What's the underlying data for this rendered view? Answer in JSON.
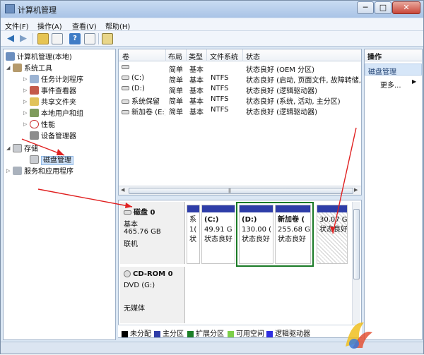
{
  "window": {
    "title": "计算机管理",
    "tooltip": "关闭",
    "min_glyph": "─",
    "max_glyph": "□",
    "close_glyph": "✕"
  },
  "menu": [
    "文件(F)",
    "操作(A)",
    "查看(V)",
    "帮助(H)"
  ],
  "toolbar": {
    "back_glyph": "◀",
    "forward_glyph": "▶",
    "help_glyph": "?"
  },
  "tree": {
    "items": [
      {
        "label": "计算机管理(本地)"
      },
      {
        "label": "系统工具"
      },
      {
        "label": "任务计划程序"
      },
      {
        "label": "事件查看器"
      },
      {
        "label": "共享文件夹"
      },
      {
        "label": "本地用户和组"
      },
      {
        "label": "性能"
      },
      {
        "label": "设备管理器"
      },
      {
        "label": "存储"
      },
      {
        "label": "磁盘管理"
      },
      {
        "label": "服务和应用程序"
      }
    ]
  },
  "volumes": {
    "headers": [
      "卷",
      "布局",
      "类型",
      "文件系统",
      "状态"
    ],
    "rows": [
      {
        "name": "",
        "layout": "简单",
        "type": "基本",
        "fs": "",
        "status": "状态良好 (OEM 分区)"
      },
      {
        "name": "(C:)",
        "layout": "简单",
        "type": "基本",
        "fs": "NTFS",
        "status": "状态良好 (启动, 页面文件, 故障转储,"
      },
      {
        "name": "(D:)",
        "layout": "简单",
        "type": "基本",
        "fs": "NTFS",
        "status": "状态良好 (逻辑驱动器)"
      },
      {
        "name": "系统保留",
        "layout": "简单",
        "type": "基本",
        "fs": "NTFS",
        "status": "状态良好 (系统, 活动, 主分区)"
      },
      {
        "name": "新加卷 (E:)",
        "layout": "简单",
        "type": "基本",
        "fs": "NTFS",
        "status": "状态良好 (逻辑驱动器)"
      }
    ],
    "scroll_left": "◀",
    "scroll_right": "▶",
    "scroll_grip": "|||"
  },
  "disks": [
    {
      "name": "磁盘 0",
      "kind": "基本",
      "size": "465.76 GB",
      "status": "联机",
      "partitions": [
        {
          "line1": "系",
          "line2": "1(",
          "line3": "状"
        },
        {
          "line1": "(C:)",
          "line2": "49.91 G",
          "line3": "状态良好"
        },
        {
          "line1": "(D:)",
          "line2": "130.00 (",
          "line3": "状态良好"
        },
        {
          "line1": "新加卷 (",
          "line2": "255.68 G",
          "line3": "状态良好"
        },
        {
          "line1": "",
          "line2": "30.07 G",
          "line3": "状态良好"
        }
      ]
    },
    {
      "name": "CD-ROM 0",
      "kind": "DVD (G:)",
      "status": "无媒体"
    }
  ],
  "legend": [
    {
      "label": "未分配",
      "color": "#000000"
    },
    {
      "label": "主分区",
      "color": "#2e3da8"
    },
    {
      "label": "扩展分区",
      "color": "#1c7f27"
    },
    {
      "label": "可用空间",
      "color": "#7ccf4a"
    },
    {
      "label": "逻辑驱动器",
      "color": "#2f2fe0"
    }
  ],
  "actions": {
    "header": "操作",
    "section": "磁盘管理",
    "more": "更多...",
    "more_arrow": "▶"
  }
}
